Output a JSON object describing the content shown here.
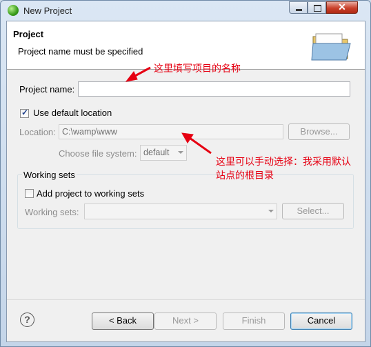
{
  "window": {
    "title": "New Project"
  },
  "header": {
    "title": "Project",
    "message": "Project name must be specified"
  },
  "form": {
    "project_name_label": "Project name:",
    "project_name_value": "",
    "use_default_location_label": "Use default location",
    "use_default_location_checked": true,
    "location_label": "Location:",
    "location_value": "C:\\wamp\\www",
    "browse_label": "Browse...",
    "file_system_label": "Choose file system:",
    "file_system_value": "default"
  },
  "working_sets": {
    "group_label": "Working sets",
    "add_label": "Add project to working sets",
    "add_checked": false,
    "sets_label": "Working sets:",
    "sets_value": "",
    "select_label": "Select..."
  },
  "buttons": {
    "back": "< Back",
    "next": "Next >",
    "finish": "Finish",
    "cancel": "Cancel"
  },
  "annotations": {
    "name_note": "这里填写项目的名称",
    "location_note_line1": "这里可以手动选择：我采用默认",
    "location_note_line2": "站点的根目录"
  },
  "colors": {
    "annotation": "#e60012",
    "close_button": "#c9402a"
  },
  "icons": {
    "app": "eclipse-app-icon",
    "wizard": "open-folder-icon",
    "help": "help-icon"
  }
}
